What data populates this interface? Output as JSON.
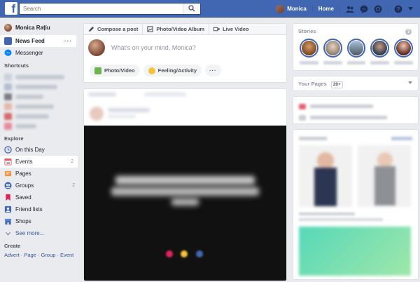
{
  "header": {
    "search_placeholder": "Search",
    "user_name": "Monica",
    "home_label": "Home",
    "icons": [
      "facebook-logo",
      "search-icon",
      "friend-requests-icon",
      "messenger-icon",
      "notifications-icon",
      "help-icon"
    ]
  },
  "sidebar": {
    "profile_name": "Monica Rațiu",
    "items": [
      {
        "label": "News Feed",
        "icon": "news-feed-icon"
      },
      {
        "label": "Messenger",
        "icon": "messenger-icon"
      }
    ],
    "shortcuts_title": "Shortcuts",
    "explore_title": "Explore",
    "explore": [
      {
        "label": "On this Day",
        "icon": "clock-icon",
        "count": ""
      },
      {
        "label": "Events",
        "icon": "calendar-icon",
        "count": "2"
      },
      {
        "label": "Pages",
        "icon": "flag-icon",
        "count": ""
      },
      {
        "label": "Groups",
        "icon": "groups-icon",
        "count": "2"
      },
      {
        "label": "Saved",
        "icon": "bookmark-icon",
        "count": ""
      },
      {
        "label": "Friend lists",
        "icon": "friend-list-icon",
        "count": ""
      },
      {
        "label": "Shops",
        "icon": "shop-icon",
        "count": ""
      }
    ],
    "see_more": "See more...",
    "create_title": "Create",
    "create_links": "Advert · Page · Group · Event"
  },
  "composer": {
    "tabs": [
      {
        "label": "Compose a post",
        "icon": "pencil-icon"
      },
      {
        "label": "Photo/Video Album",
        "icon": "album-icon"
      },
      {
        "label": "Live Video",
        "icon": "video-camera-icon"
      }
    ],
    "placeholder": "What's on your mind, Monica?",
    "actions": [
      {
        "label": "Photo/Video",
        "icon": "photo-icon"
      },
      {
        "label": "Feeling/Activity",
        "icon": "smiley-icon"
      },
      {
        "label": "",
        "icon": "more-icon"
      }
    ]
  },
  "right": {
    "stories_title": "Stories",
    "your_pages_title": "Your Pages",
    "your_pages_badge": "20+"
  },
  "colors": {
    "brand": "#4267b2",
    "background": "#e9ebee",
    "link": "#365899"
  }
}
